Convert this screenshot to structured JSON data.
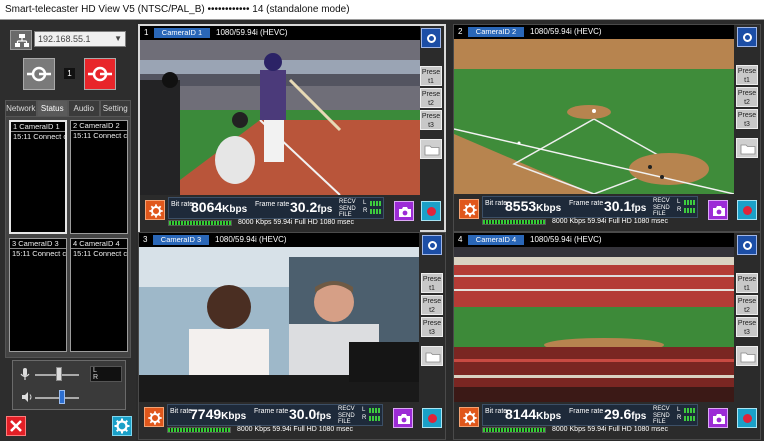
{
  "window": {
    "title": "Smart-telecaster HD View V5 (NTSC/PAL_B) •••••••••••• 14 (standalone mode)"
  },
  "left_panel": {
    "ip_address": "192.168.55.1",
    "channel_badge": "1",
    "tabs": [
      "Network",
      "Status",
      "Audio",
      "Setting"
    ],
    "active_tab": "Status",
    "camera_boxes": [
      {
        "title": "1 CameraID 1",
        "status": "15:11 Connect co"
      },
      {
        "title": "2 CameraID 2",
        "status": "15:11 Connect co"
      },
      {
        "title": "3 CameraID 3",
        "status": "15:11 Connect co"
      },
      {
        "title": "4 CameraID 4",
        "status": "15:11 Connect co"
      }
    ],
    "audio": {
      "meter_l": "L",
      "meter_r": "R",
      "mic_level": 0.55,
      "speaker_level": 0.62
    }
  },
  "panels": [
    {
      "number": "1",
      "camera": "CameraID 1",
      "resolution": "1080/59.94i (HEVC)",
      "bitrate": "8064",
      "bitrate_unit": "Kbps",
      "fps": "30.2",
      "fps_unit": "fps",
      "bitrate_label": "Bit rate",
      "fps_label": "Frame rate",
      "sub": "8000 Kbps   59.94i   Full HD      1080 msec",
      "presets": [
        "Prese t1",
        "Prese t2",
        "Prese t3"
      ],
      "scene": "baseball-batter"
    },
    {
      "number": "2",
      "camera": "CameraID 2",
      "resolution": "1080/59.94i (HEVC)",
      "bitrate": "8553",
      "bitrate_unit": "Kbps",
      "fps": "30.1",
      "fps_unit": "fps",
      "bitrate_label": "Bit rate",
      "fps_label": "Frame rate",
      "sub": "8000 Kbps   59.94i   Full HD      1080 msec",
      "presets": [
        "Prese t1",
        "Prese t2",
        "Prese t3"
      ],
      "scene": "baseball-field"
    },
    {
      "number": "3",
      "camera": "CameraID 3",
      "resolution": "1080/59.94i (HEVC)",
      "bitrate": "7749",
      "bitrate_unit": "Kbps",
      "fps": "30.0",
      "fps_unit": "fps",
      "bitrate_label": "Bit rate",
      "fps_label": "Frame rate",
      "sub": "8000 Kbps   59.94i   Full HD      1080 msec",
      "presets": [
        "Prese t1",
        "Prese t2",
        "Prese t3"
      ],
      "scene": "commentators"
    },
    {
      "number": "4",
      "camera": "CameraID 4",
      "resolution": "1080/59.94i (HEVC)",
      "bitrate": "8144",
      "bitrate_unit": "Kbps",
      "fps": "29.6",
      "fps_unit": "fps",
      "bitrate_label": "Bit rate",
      "fps_label": "Frame rate",
      "sub": "8000 Kbps   59.94i   Full HD      1080 msec",
      "presets": [
        "Prese t1",
        "Prese t2",
        "Prese t3"
      ],
      "scene": "stadium-crowd"
    }
  ],
  "stat_flags": {
    "recv": "RECV",
    "send": "SEND",
    "file": "FILE",
    "l": "L",
    "r": "R"
  },
  "colors": {
    "accent_blue": "#2a67b8",
    "record_cyan": "#1aa0c8",
    "gear_orange": "#e0571b",
    "camera_purple": "#9c2bd6",
    "close_red": "#e21f26"
  }
}
